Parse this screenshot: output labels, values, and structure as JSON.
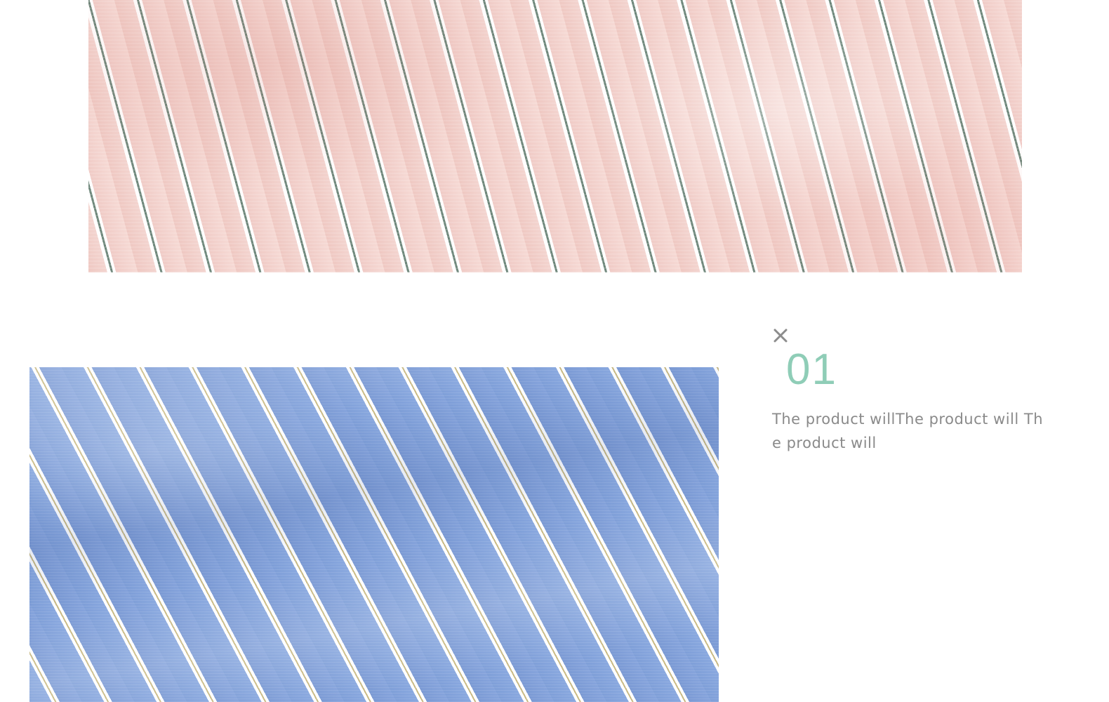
{
  "hero_image": {
    "description_icon": "striped-fabric-pink",
    "colors": {
      "base": "#f3d4cf",
      "stripe_white": "#ffffff",
      "stripe_dark": "#6f877b"
    }
  },
  "detail_image": {
    "description_icon": "striped-fabric-blue",
    "colors": {
      "base": "#86a4dc",
      "stripe_white": "#ffffff",
      "stripe_accent": "#c8b983"
    }
  },
  "info": {
    "close_icon": "close-icon",
    "number": "01",
    "description": "The product willThe product will The product will",
    "colors": {
      "number": "#8fcdb7",
      "text": "#8a8a8a",
      "icon": "#8c8c8c"
    }
  }
}
